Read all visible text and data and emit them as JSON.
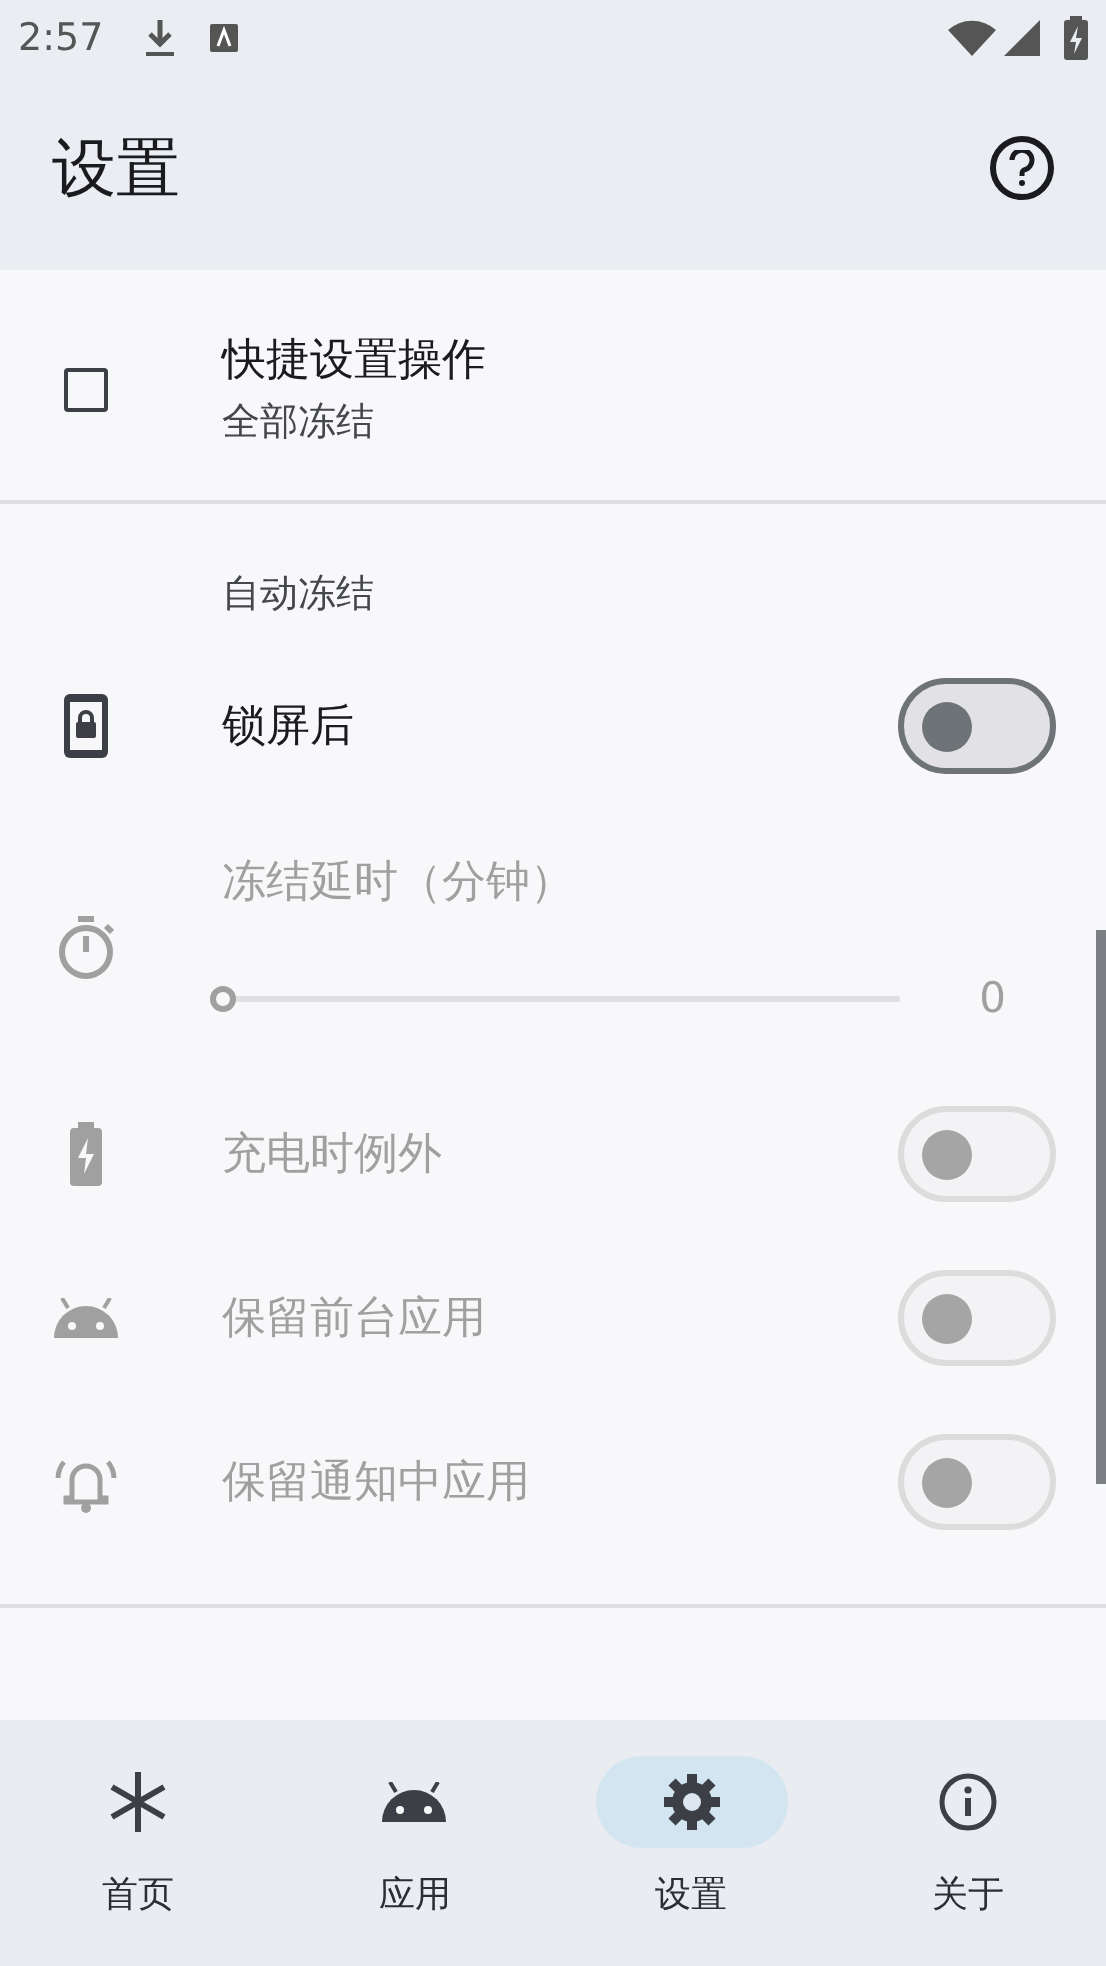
{
  "status_bar": {
    "time": "2:57"
  },
  "app_bar": {
    "title": "设置"
  },
  "settings": [
    {
      "kind": "checkbox",
      "title": "快捷设置操作",
      "summary": "全部冻结",
      "checked": false
    },
    {
      "kind": "divider"
    },
    {
      "kind": "header",
      "title": "自动冻结"
    },
    {
      "kind": "switch",
      "title": "锁屏后",
      "on": false,
      "disabled": false
    },
    {
      "kind": "slider",
      "title": "冻结延时（分钟）",
      "level": 0,
      "reading": "0",
      "disabled": true
    },
    {
      "kind": "switch",
      "title": "充电时例外",
      "on": false,
      "disabled": true
    },
    {
      "kind": "switch",
      "title": "保留前台应用",
      "on": false,
      "disabled": true
    },
    {
      "kind": "switch",
      "title": "保留通知中应用",
      "on": false,
      "disabled": true
    },
    {
      "kind": "divider"
    }
  ],
  "nav": [
    {
      "label": "首页",
      "selected": false
    },
    {
      "label": "应用",
      "selected": false
    },
    {
      "label": "设置",
      "selected": true
    },
    {
      "label": "关于",
      "selected": false
    }
  ]
}
